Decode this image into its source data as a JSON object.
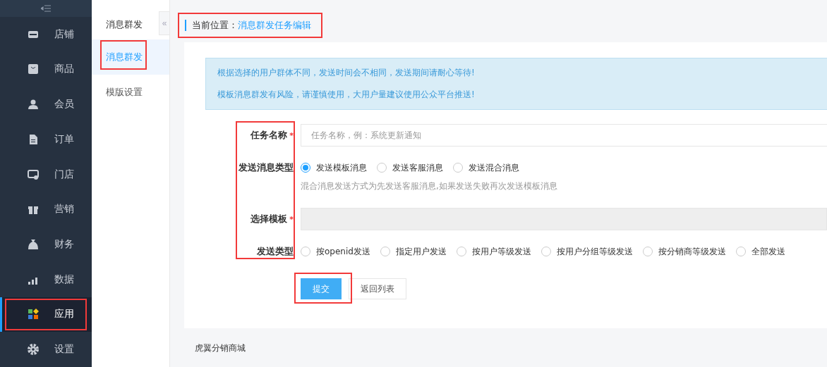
{
  "sidebar": {
    "items": [
      {
        "label": "店铺",
        "selected": false,
        "annotated": false
      },
      {
        "label": "商品",
        "selected": false,
        "annotated": false
      },
      {
        "label": "会员",
        "selected": false,
        "annotated": false
      },
      {
        "label": "订单",
        "selected": false,
        "annotated": false
      },
      {
        "label": "门店",
        "selected": false,
        "annotated": false
      },
      {
        "label": "营销",
        "selected": false,
        "annotated": false
      },
      {
        "label": "财务",
        "selected": false,
        "annotated": false
      },
      {
        "label": "数据",
        "selected": false,
        "annotated": false
      },
      {
        "label": "应用",
        "selected": true,
        "annotated": true
      },
      {
        "label": "设置",
        "selected": false,
        "annotated": false
      }
    ]
  },
  "subnav": {
    "title": "消息群发",
    "collapse": "«",
    "items": [
      {
        "label": "消息群发",
        "selected": true,
        "annotated": true
      },
      {
        "label": "模版设置",
        "selected": false,
        "annotated": false
      }
    ]
  },
  "breadcrumb": {
    "label": "当前位置：",
    "current": "消息群发任务编辑",
    "annotated": true
  },
  "notice": [
    "根据选择的用户群体不同，发送时间会不相同，发送期间请耐心等待!",
    "模板消息群发有风险，请谨慎使用，大用户量建议使用公众平台推送!"
  ],
  "form": {
    "labels_annotated": true,
    "rows": [
      {
        "kind": "input",
        "label": "任务名称",
        "required_mark": "*",
        "placeholder": "任务名称，例：系统更新通知"
      },
      {
        "kind": "radio",
        "label": "发送消息类型",
        "options": [
          {
            "label": "发送模板消息",
            "selected": true
          },
          {
            "label": "发送客服消息",
            "selected": false
          },
          {
            "label": "发送混合消息",
            "selected": false
          }
        ],
        "hint": "混合消息发送方式为先发送客服消息,如果发送失败再次发送模板消息"
      },
      {
        "kind": "select",
        "label": "选择模板",
        "required_mark": "*",
        "disabled": true
      },
      {
        "kind": "radio",
        "label": "发送类型",
        "options": [
          {
            "label": "按openid发送",
            "selected": false
          },
          {
            "label": "指定用户发送",
            "selected": false
          },
          {
            "label": "按用户等级发送",
            "selected": false
          },
          {
            "label": "按用户分组等级发送",
            "selected": false
          },
          {
            "label": "按分销商等级发送",
            "selected": false
          },
          {
            "label": "全部发送",
            "selected": false
          }
        ]
      }
    ],
    "submit": {
      "label": "提交",
      "annotated": true
    },
    "back": "返回列表"
  },
  "footer": "虎翼分销商城"
}
